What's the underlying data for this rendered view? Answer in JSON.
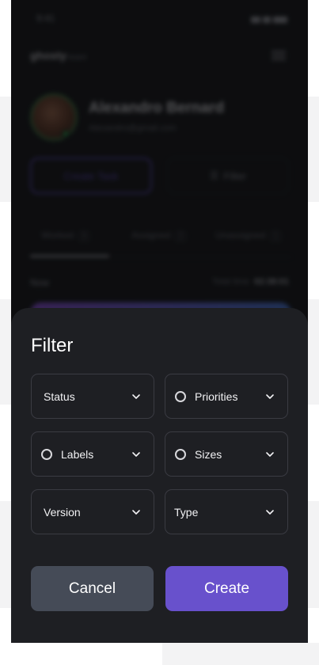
{
  "background": {
    "page": "#ffffff",
    "stripe": "#f3f3f4",
    "phone": "#141518"
  },
  "status_bar": {
    "time": "9:41"
  },
  "app": {
    "brand": "ghosty",
    "brand_sub": "board"
  },
  "profile": {
    "name": "Alexandro Bernard",
    "email": "Alexandro@gmail.com"
  },
  "actions": {
    "create_task": "Create Task",
    "filter": "Filter"
  },
  "tabs": [
    {
      "label": "Worked",
      "count": "3"
    },
    {
      "label": "Assigned",
      "count": "2"
    },
    {
      "label": "Unassigned",
      "count": "1"
    }
  ],
  "list": {
    "section": "Now",
    "total_label": "Total time",
    "total_value": "02:38:01"
  },
  "filter_sheet": {
    "title": "Filter",
    "selects": [
      {
        "label": "Status",
        "icon": "none"
      },
      {
        "label": "Priorities",
        "icon": "circle-icon"
      },
      {
        "label": "Labels",
        "icon": "circle-icon"
      },
      {
        "label": "Sizes",
        "icon": "circle-icon"
      },
      {
        "label": "Version",
        "icon": "none"
      },
      {
        "label": "Type",
        "icon": "none"
      }
    ],
    "cancel_label": "Cancel",
    "create_label": "Create",
    "colors": {
      "sheet": "#1e1f23",
      "cancel": "#454b57",
      "create": "#6851cc"
    }
  }
}
